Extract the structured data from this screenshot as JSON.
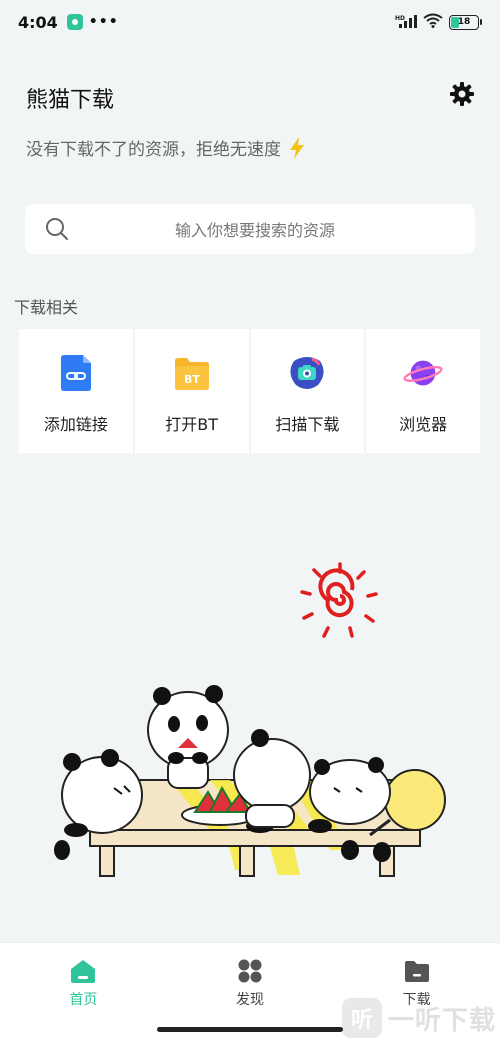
{
  "status_bar": {
    "time": "4:04",
    "dots": "•••",
    "battery": "18",
    "signal_label": "HD"
  },
  "header": {
    "title": "熊猫下载",
    "settings_icon": "gear-icon",
    "slogan": "没有下载不了的资源，拒绝无速度",
    "slogan_icon": "lightning-icon"
  },
  "search": {
    "placeholder": "输入你想要搜索的资源"
  },
  "download_section": {
    "title": "下载相关",
    "items": [
      {
        "label": "添加链接",
        "icon": "link-icon",
        "color": "#2f7bf5"
      },
      {
        "label": "打开BT",
        "icon": "bt-folder-icon",
        "color": "#f7b52b"
      },
      {
        "label": "扫描下载",
        "icon": "camera-scan-icon",
        "color": "#3a58c9"
      },
      {
        "label": "浏览器",
        "icon": "planet-icon",
        "color": "#8a3ff0"
      }
    ]
  },
  "bottom_nav": {
    "items": [
      {
        "label": "首页",
        "icon": "home-icon",
        "active": true
      },
      {
        "label": "发现",
        "icon": "discover-icon",
        "active": false
      },
      {
        "label": "下载",
        "icon": "folder-icon",
        "active": false
      }
    ]
  },
  "watermark": {
    "logo_text": "听",
    "text": "一听下载"
  },
  "colors": {
    "accent": "#2fc49a",
    "background": "#f2f5f5"
  }
}
